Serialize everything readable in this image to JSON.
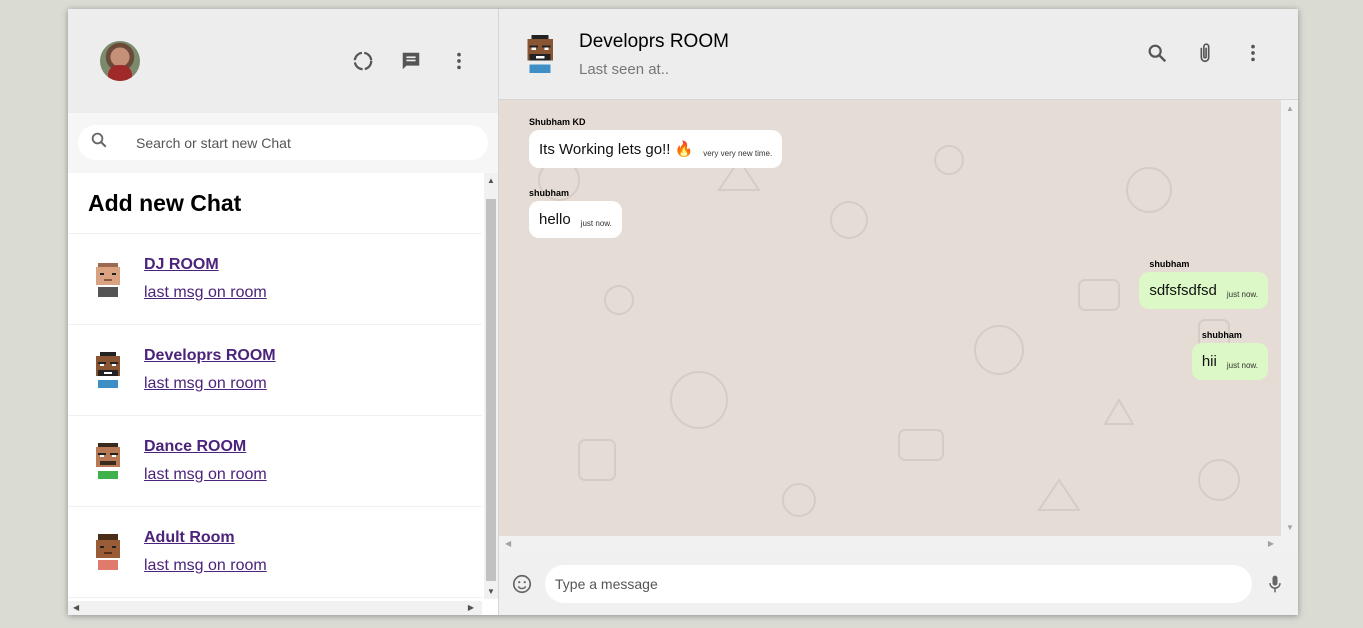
{
  "sidebar": {
    "search_placeholder": "Search or start new Chat",
    "add_new_chat": "Add new Chat",
    "chats": [
      {
        "name": "DJ ROOM",
        "last": "last msg on room"
      },
      {
        "name": "Developrs ROOM",
        "last": "last msg on room"
      },
      {
        "name": "Dance ROOM",
        "last": "last msg on room"
      },
      {
        "name": "Adult Room",
        "last": "last msg on room"
      }
    ]
  },
  "header": {
    "room_name": "Developrs ROOM",
    "last_seen": "Last seen at.."
  },
  "messages": [
    {
      "author": "Shubham KD",
      "text": "Its Working lets go!! 🔥",
      "time": "very very new time.",
      "outgoing": false
    },
    {
      "author": "shubham",
      "text": "hello",
      "time": "just now.",
      "outgoing": false
    },
    {
      "author": "shubham",
      "text": "sdfsfsdfsd",
      "time": "just now.",
      "outgoing": true
    },
    {
      "author": "shubham",
      "text": "hii",
      "time": "just now.",
      "outgoing": true
    }
  ],
  "footer": {
    "placeholder": "Type a message"
  },
  "colors": {
    "outgoing_bubble": "#dcf8c6",
    "incoming_bubble": "#ffffff",
    "chat_bg": "#e5ddd5",
    "link": "#4c237a"
  },
  "icons": [
    "status-icon",
    "new-chat-icon",
    "menu-icon",
    "search-icon",
    "attach-icon",
    "emoji-icon",
    "mic-icon"
  ]
}
